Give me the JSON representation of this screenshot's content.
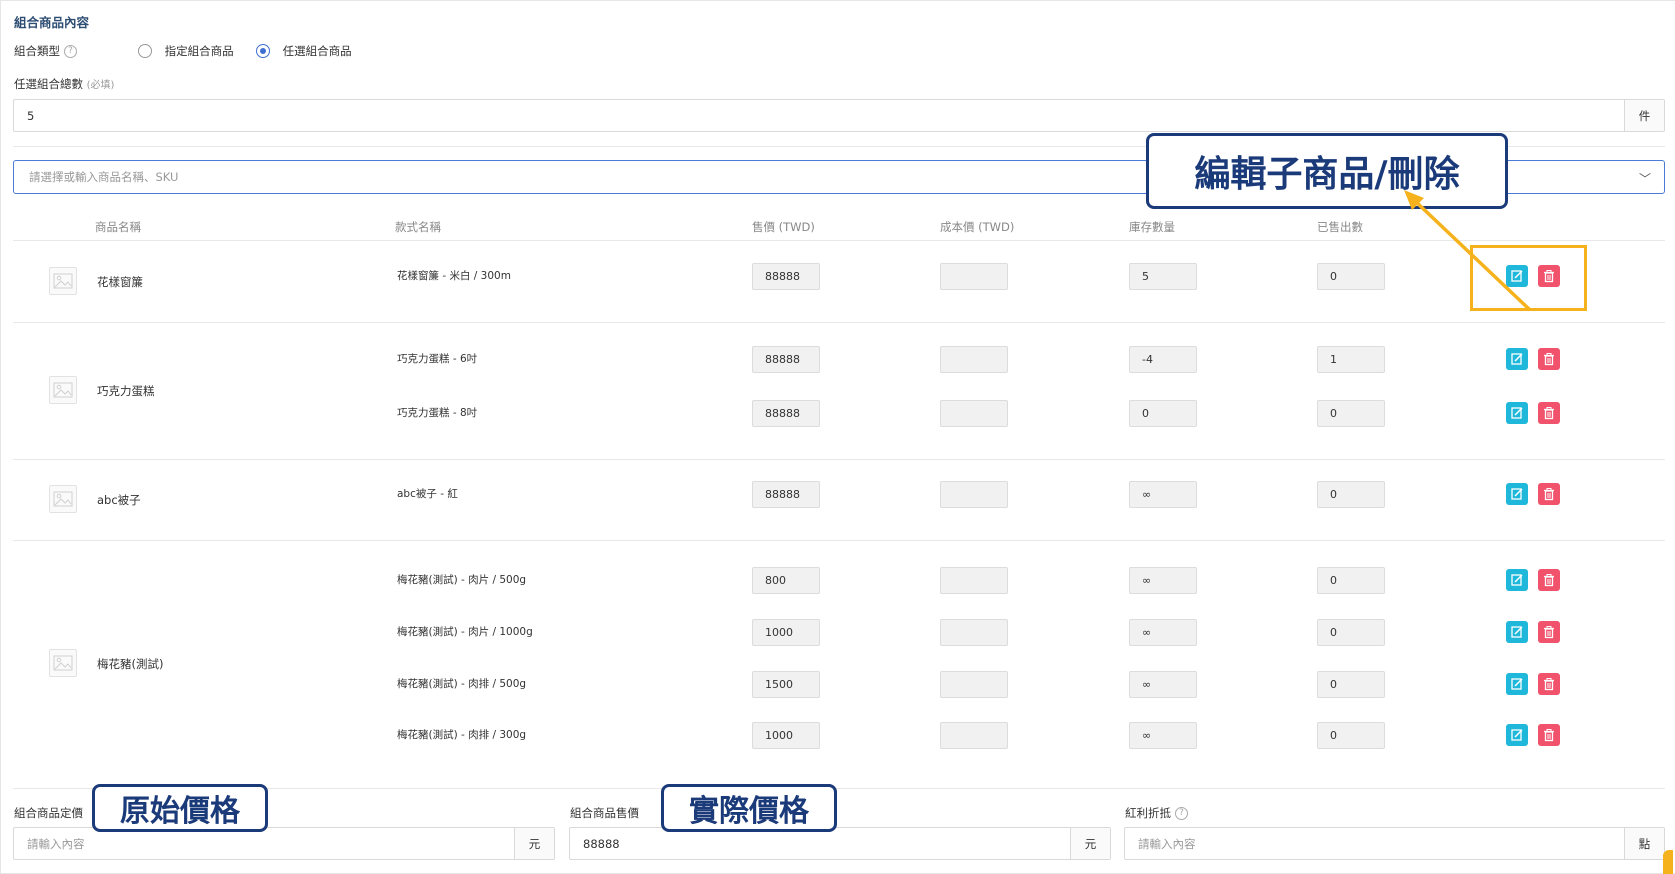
{
  "section_title": "組合商品內容",
  "combo_type": {
    "label": "組合類型",
    "help": "?",
    "options": [
      {
        "label": "指定組合商品",
        "selected": false
      },
      {
        "label": "任選組合商品",
        "selected": true
      }
    ]
  },
  "total_count": {
    "label": "任選組合總數",
    "required": "(必填)",
    "value": "5",
    "unit": "件"
  },
  "product_select": {
    "placeholder": "請選擇或輸入商品名稱、SKU"
  },
  "table": {
    "headers": [
      "商品名稱",
      "款式名稱",
      "售價 (TWD)",
      "成本價 (TWD)",
      "庫存數量",
      "已售出數"
    ],
    "groups": [
      {
        "name": "花樣窗簾",
        "variants": [
          {
            "name": "花樣窗簾 - 米白 / 300m",
            "price": "88888",
            "cost": "",
            "stock": "5",
            "sold": "0"
          }
        ]
      },
      {
        "name": "巧克力蛋糕",
        "variants": [
          {
            "name": "巧克力蛋糕 - 6吋",
            "price": "88888",
            "cost": "",
            "stock": "-4",
            "sold": "1"
          },
          {
            "name": "巧克力蛋糕 - 8吋",
            "price": "88888",
            "cost": "",
            "stock": "0",
            "sold": "0"
          }
        ]
      },
      {
        "name": "abc被子",
        "variants": [
          {
            "name": "abc被子 - 紅",
            "price": "88888",
            "cost": "",
            "stock": "∞",
            "sold": "0"
          }
        ]
      },
      {
        "name": "梅花豬(測試)",
        "variants": [
          {
            "name": "梅花豬(測試) - 肉片 / 500g",
            "price": "800",
            "cost": "",
            "stock": "∞",
            "sold": "0"
          },
          {
            "name": "梅花豬(測試) - 肉片 / 1000g",
            "price": "1000",
            "cost": "",
            "stock": "∞",
            "sold": "0"
          },
          {
            "name": "梅花豬(測試) - 肉排 / 500g",
            "price": "1500",
            "cost": "",
            "stock": "∞",
            "sold": "0"
          },
          {
            "name": "梅花豬(測試) - 肉排 / 300g",
            "price": "1000",
            "cost": "",
            "stock": "∞",
            "sold": "0"
          }
        ]
      }
    ]
  },
  "footer": {
    "list_price": {
      "label": "組合商品定價",
      "placeholder": "請輸入內容",
      "unit": "元"
    },
    "sale_price": {
      "label": "組合商品售價",
      "value": "88888",
      "unit": "元"
    },
    "points": {
      "label": "紅利折抵",
      "help": "?",
      "placeholder": "請輸入內容",
      "unit": "點"
    }
  },
  "annotations": {
    "edit_delete": "編輯子商品/刪除",
    "original_price": "原始價格",
    "actual_price": "實際價格"
  },
  "colors": {
    "accent_blue": "#3f6fd0",
    "edit_button": "#1fb8da",
    "delete_button": "#f0536b",
    "callout_border": "#1b3a7a",
    "highlight": "#f5b21c"
  }
}
